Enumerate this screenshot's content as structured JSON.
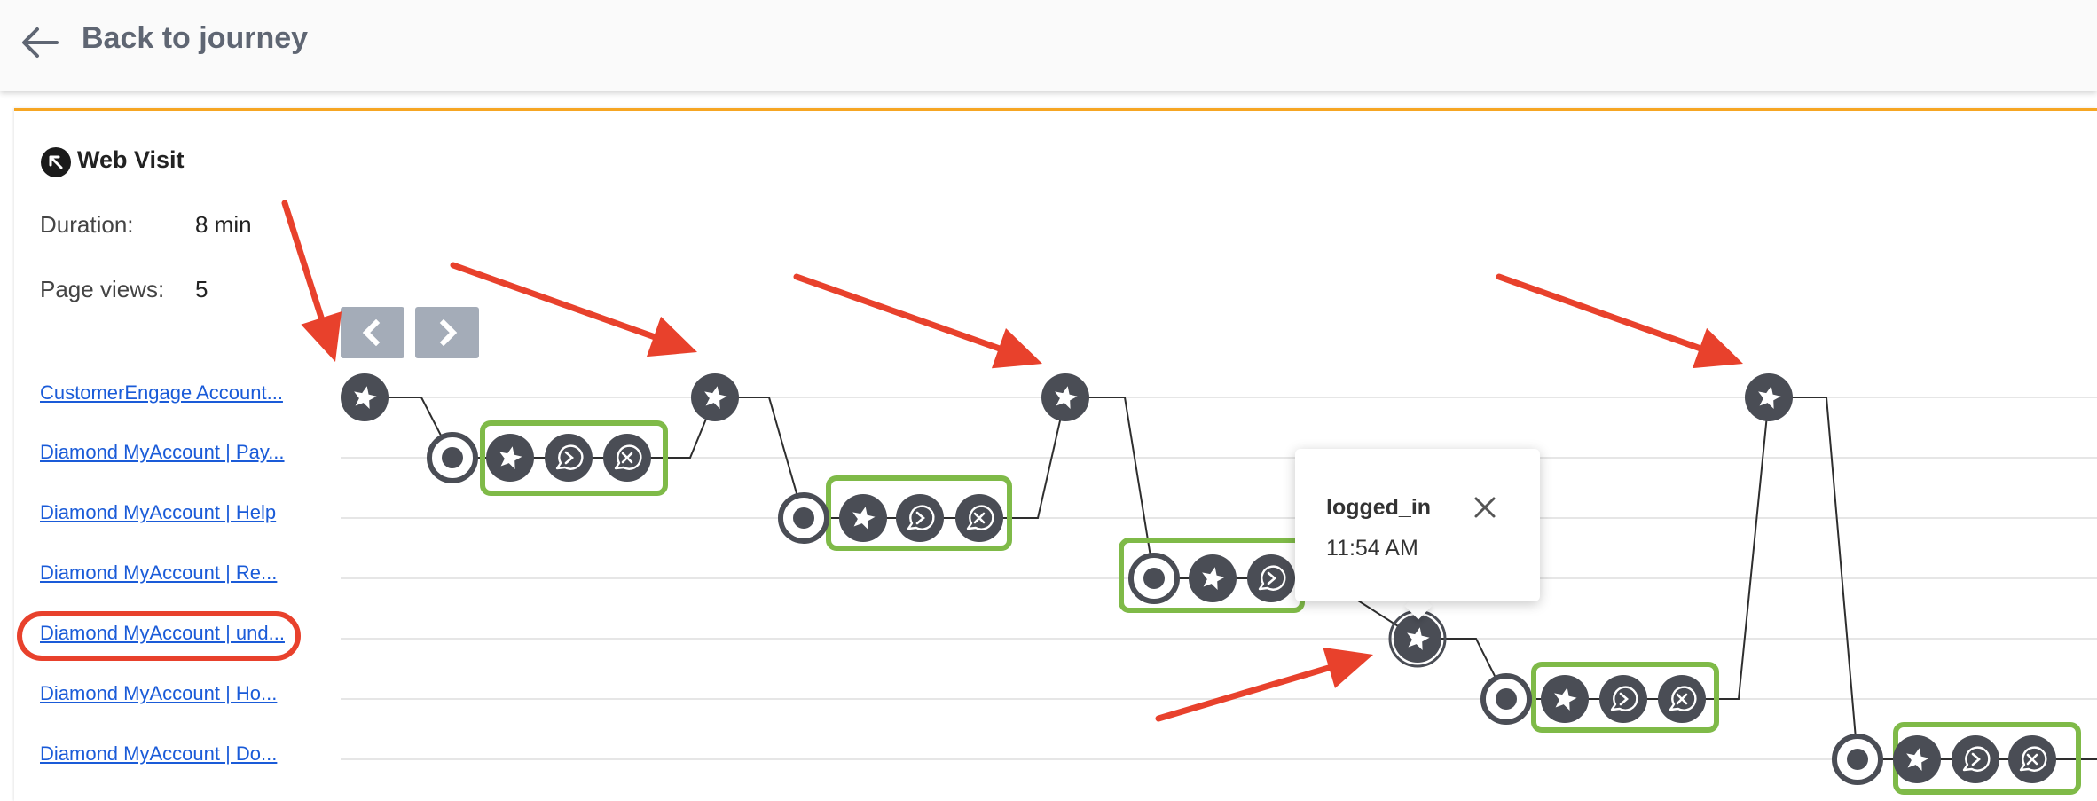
{
  "header": {
    "back_label": "Back to journey",
    "back_icon": "arrow-left-icon"
  },
  "colors": {
    "accent": "#f6a623",
    "node_dark": "#4a4d55",
    "annotation_red": "#e8412c",
    "annotation_green": "#7fba48",
    "link_blue": "#1a5bd8"
  },
  "visit": {
    "title": "Web Visit",
    "icon": "arrow-up-left-circle-icon",
    "stats": [
      {
        "label": "Duration:",
        "value": "8 min"
      },
      {
        "label": "Page views:",
        "value": "5"
      }
    ]
  },
  "pages": [
    "CustomerEngage Account...",
    "Diamond MyAccount | Pay...",
    "Diamond MyAccount | Help",
    "Diamond MyAccount | Re...",
    "Diamond MyAccount | und...",
    "Diamond MyAccount | Ho...",
    "Diamond MyAccount | Do..."
  ],
  "nav": {
    "prev_icon": "chevron-left-icon",
    "next_icon": "chevron-right-icon"
  },
  "tooltip": {
    "title": "logged_in",
    "time": "11:54 AM",
    "close_icon": "close-icon"
  }
}
